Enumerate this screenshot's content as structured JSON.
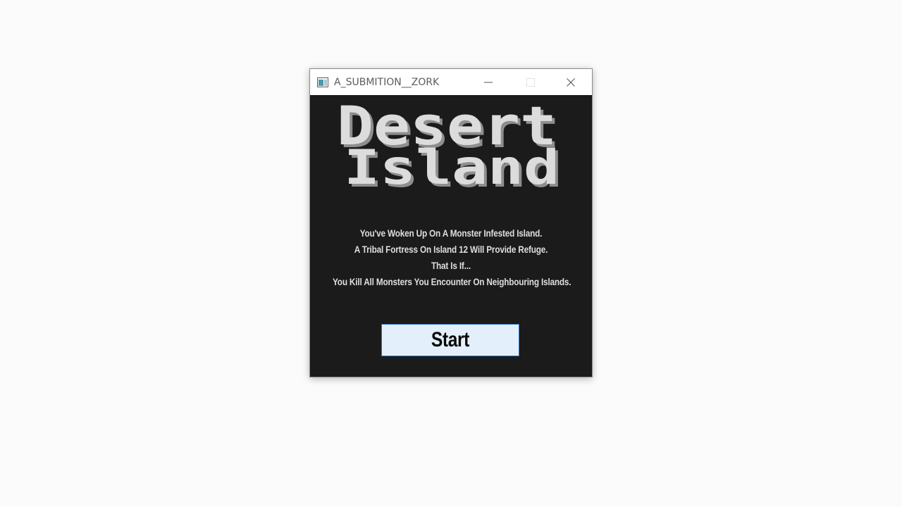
{
  "window": {
    "title": "A_SUBMITION__ZORK",
    "controls": {
      "minimize_icon": "minimize-icon",
      "maximize_icon": "maximize-icon",
      "close_icon": "close-icon"
    }
  },
  "logo": {
    "line1": "Desert",
    "line2": "Island",
    "colors": {
      "face": "#dcdcdc",
      "shadow": "#8e8e8e"
    }
  },
  "story": {
    "lines": [
      "You've Woken Up On A Monster Infested Island.",
      "A Tribal Fortress On Island 12 Will Provide Refuge.",
      "That Is If...",
      "You Kill All Monsters You Encounter On Neighbouring Islands."
    ]
  },
  "start_button": {
    "label": "Start"
  },
  "colors": {
    "window_bg": "#1b1b1b",
    "text": "#dedede",
    "button_bg": "#e3f0fb",
    "button_border": "#2d76c8"
  }
}
